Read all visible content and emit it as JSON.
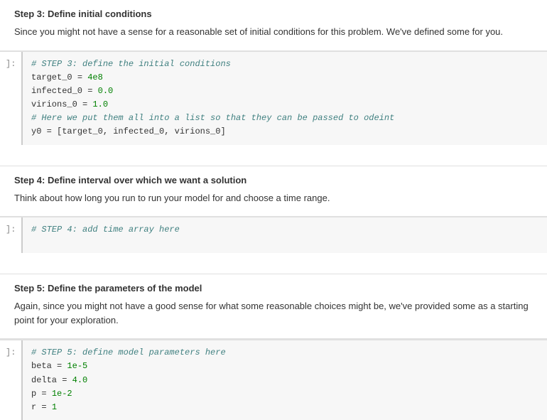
{
  "sections": [
    {
      "id": "step3",
      "heading": "Step 3: Define initial conditions",
      "description": "Since you might not have a sense for a reasonable set of initial conditions for this problem. We've defined some for you.",
      "has_code": true,
      "cell_label": "]:",
      "code_lines": [
        {
          "type": "comment",
          "text": "# STEP 3: define the initial conditions"
        },
        {
          "type": "code",
          "text": "target_0 = 4e8"
        },
        {
          "type": "code",
          "text": "infected_0 = 0.0"
        },
        {
          "type": "code",
          "text": "virions_0 = 1.0"
        },
        {
          "type": "comment",
          "text": "# Here we put them all into a list so that they can be passed to odeint"
        },
        {
          "type": "code",
          "text": "y0 = [target_0, infected_0, virions_0]"
        }
      ]
    },
    {
      "id": "step4",
      "heading": "Step 4: Define interval over which we want a solution",
      "description": "Think about how long you run to run your model for and choose a time range.",
      "has_code": true,
      "cell_label": "]:",
      "code_lines": [
        {
          "type": "comment",
          "text": "# STEP 4: add time array here"
        }
      ]
    },
    {
      "id": "step5",
      "heading": "Step 5: Define the parameters of the model",
      "description": "Again, since you might not have a good sense for what some reasonable choices might be, we've provided some as a starting point for your exploration.",
      "has_code": true,
      "cell_label": "]:",
      "code_lines": [
        {
          "type": "comment",
          "text": "# STEP 5: define model parameters here"
        },
        {
          "type": "code",
          "text": "beta = 1e-5"
        },
        {
          "type": "code",
          "text": "delta = 4.0"
        },
        {
          "type": "code",
          "text": "p = 1e-2"
        },
        {
          "type": "code",
          "text": "r = 1"
        }
      ]
    }
  ]
}
